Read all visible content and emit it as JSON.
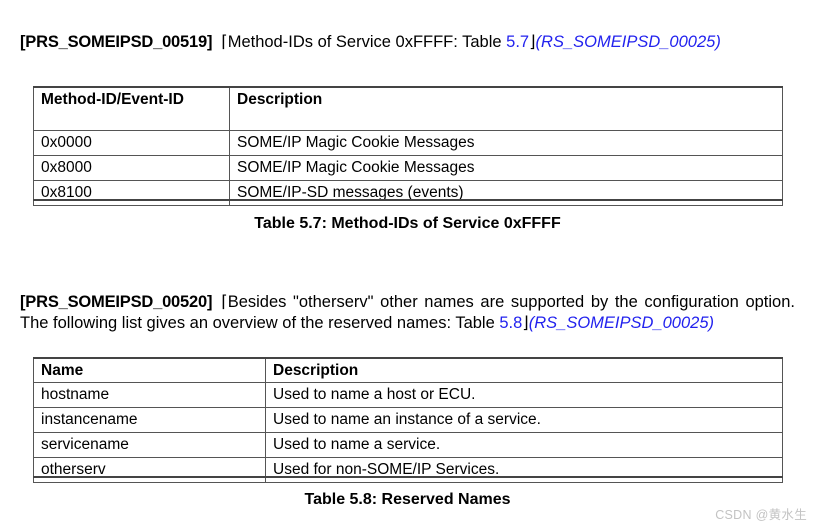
{
  "document": {
    "requirements": [
      {
        "id": "[PRS_SOMEIPSD_00519]",
        "open_bracket": "⌈",
        "text": "Method-IDs of Service 0xFFFF: Table ",
        "table_ref": "5.7",
        "close_bracket": "⌋",
        "trace_open": "(",
        "trace_ref": "RS_SOMEIPSD_00025",
        "trace_close": ")"
      },
      {
        "id": "[PRS_SOMEIPSD_00520]",
        "open_bracket": "⌈",
        "text": "Besides \"otherserv\" other names are supported by the configuration option. The following list gives an overview of the reserved names: Table ",
        "table_ref": "5.8",
        "close_bracket": "⌋",
        "trace_open": "(",
        "trace_ref": "RS_SOMEIPSD_00025",
        "trace_close": ")"
      }
    ],
    "tables": [
      {
        "name": "table-5-7",
        "headers": [
          "Method-ID/Event-ID",
          "Description"
        ],
        "rows": [
          [
            "0x0000",
            "SOME/IP Magic Cookie Messages"
          ],
          [
            "0x8000",
            "SOME/IP Magic Cookie Messages"
          ],
          [
            "0x8100",
            "SOME/IP-SD messages (events)"
          ]
        ],
        "caption": "Table 5.7: Method-IDs of Service 0xFFFF"
      },
      {
        "name": "table-5-8",
        "headers": [
          "Name",
          "Description"
        ],
        "rows": [
          [
            "hostname",
            "Used to name a host or ECU."
          ],
          [
            "instancename",
            "Used to name an instance of a service."
          ],
          [
            "servicename",
            "Used to name a service."
          ],
          [
            "otherserv",
            "Used for non-SOME/IP Services."
          ]
        ],
        "caption": "Table 5.8: Reserved Names"
      }
    ],
    "watermark": "CSDN @黄水生"
  },
  "colors": {
    "link": "#2222ee",
    "text": "#000000",
    "table_border": "#555555",
    "watermark": "#c3c3c3"
  }
}
